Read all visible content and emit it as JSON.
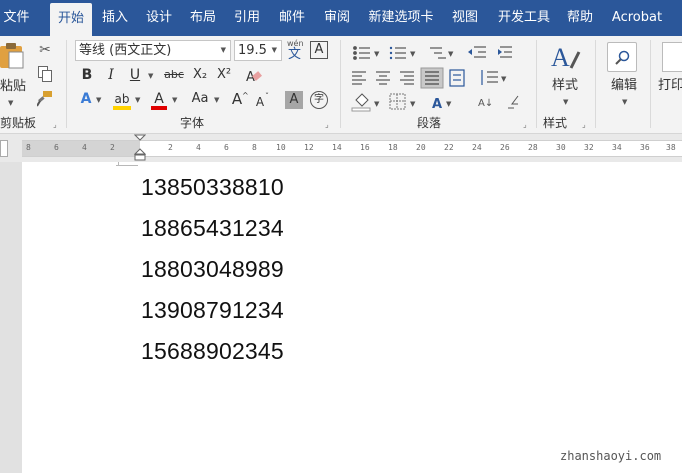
{
  "tabs": [
    "文件",
    "开始",
    "插入",
    "设计",
    "布局",
    "引用",
    "邮件",
    "审阅",
    "新建选项卡",
    "视图",
    "开发工具",
    "帮助",
    "Acrobat"
  ],
  "clipboard": {
    "paste_label": "粘贴",
    "group_label": "剪贴板"
  },
  "font": {
    "name": "等线 (西文正文)",
    "size": "19.5",
    "phonetic_label": "wén",
    "phonetic_char": "文",
    "border_char": "A",
    "bold": "B",
    "italic": "I",
    "underline": "U",
    "strike": "abc",
    "subscript": "X₂",
    "superscript": "X²",
    "texteffect": "A",
    "highlight": "ab",
    "fontcolor": "A",
    "changecase": "Aa",
    "grow": "A",
    "shrink": "A",
    "shading": "A",
    "enclose": "字",
    "group_label": "字体"
  },
  "paragraph": {
    "group_label": "段落"
  },
  "styles": {
    "label": "样式",
    "group_label": "样式"
  },
  "editing": {
    "label": "编辑"
  },
  "print": {
    "label": "打印"
  },
  "ruler": {
    "left_nums": [
      "8",
      "6",
      "4",
      "2"
    ],
    "right_nums": [
      "2",
      "4",
      "6",
      "8",
      "10",
      "12",
      "14",
      "16",
      "18",
      "20",
      "22",
      "24",
      "26",
      "28",
      "30",
      "32",
      "34",
      "36",
      "38"
    ]
  },
  "document": {
    "lines": [
      "13850338810",
      "18865431234",
      "18803048989",
      "13908791234",
      "15688902345"
    ]
  },
  "watermark": "zhanshaoyi.com"
}
